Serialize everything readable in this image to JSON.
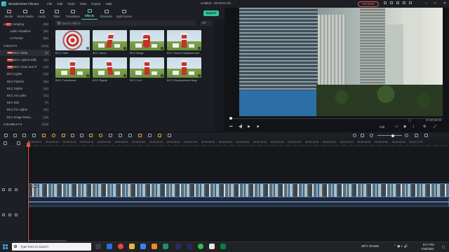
{
  "app": {
    "name": "Wondershare Filmora",
    "menu": [
      "File",
      "Edit",
      "Tools",
      "View",
      "Export",
      "Help"
    ],
    "document_title": "Untitled : 00:03:01:19",
    "purchase_label": "Purchase",
    "window_controls": [
      "–",
      "□",
      "✕"
    ]
  },
  "tabs": [
    {
      "label": "Media"
    },
    {
      "label": "Stock Media"
    },
    {
      "label": "Audio"
    },
    {
      "label": "Titles"
    },
    {
      "label": "Transitions"
    },
    {
      "label": "Effects"
    },
    {
      "label": "Elements"
    },
    {
      "label": "Split Screen"
    }
  ],
  "export_label": "Export",
  "search": {
    "placeholder": "Search effects",
    "filter": "All"
  },
  "categories": [
    {
      "label": "Camping",
      "count": "(39)",
      "hot": "HOT",
      "indent": 0
    },
    {
      "label": "Audio Visualizer",
      "count": "(25)",
      "hot": "",
      "indent": 1
    },
    {
      "label": "AI Portrait",
      "count": "(62)",
      "hot": "",
      "indent": 1
    },
    {
      "label": "Boris FX",
      "count": "(133)",
      "hot": "",
      "indent": 0
    },
    {
      "label": "BCC Warp",
      "count": "(8)",
      "hot": "NEW",
      "indent": 2
    },
    {
      "label": "BCC Optical Diffu...",
      "count": "(11)",
      "hot": "NEW",
      "indent": 2
    },
    {
      "label": "BCC Grain and Te...",
      "count": "(12)",
      "hot": "NEW",
      "indent": 2
    },
    {
      "label": "BCC Lights",
      "count": "(12)",
      "hot": "",
      "indent": 2
    },
    {
      "label": "BCC Particle",
      "count": "(11)",
      "hot": "",
      "indent": 2
    },
    {
      "label": "BCC Stylize",
      "count": "(11)",
      "hot": "",
      "indent": 2
    },
    {
      "label": "BCC Art Looks",
      "count": "(11)",
      "hot": "",
      "indent": 2
    },
    {
      "label": "BCC Blur",
      "count": "(7)",
      "hot": "",
      "indent": 2
    },
    {
      "label": "BCC Pro Lights",
      "count": "(11)",
      "hot": "",
      "indent": 2
    },
    {
      "label": "BCC Image Resto...",
      "count": "(13)",
      "hot": "",
      "indent": 2
    },
    {
      "label": "NewBlue FX",
      "count": "(112)",
      "hot": "",
      "indent": 0
    }
  ],
  "effects": [
    {
      "label": "BCC Twirl",
      "style": "twirl"
    },
    {
      "label": "BCC Wave",
      "style": "wave"
    },
    {
      "label": "BCC Bulge",
      "style": "bulge"
    },
    {
      "label": "BCC Vector Displacement",
      "style": "plain"
    },
    {
      "label": "BCC Turbulence",
      "style": "plain"
    },
    {
      "label": "BCC Ripple",
      "style": "ripple"
    },
    {
      "label": "BCC Curl",
      "style": "plain"
    },
    {
      "label": "BCC Displacement Map",
      "style": "plain"
    }
  ],
  "preview": {
    "current_time": "00:00:00:00",
    "quality": "Full",
    "braces": "{      }"
  },
  "timeline": {
    "ruler": [
      "00:00:00:00",
      "00:00:00:20",
      "00:00:01:15",
      "00:00:02:10",
      "00:00:03:05",
      "00:00:04:00",
      "00:00:04:20",
      "00:00:05:15",
      "00:00:06:10",
      "00:00:07:05",
      "00:00:08:00",
      "00:00:08:20",
      "00:00:09:15",
      "00:00:10:10",
      "00:00:11:05",
      "00:00:12:00",
      "00:00:12:20",
      "00:00:13:15",
      "00:00:14:10",
      "00:00:15:05",
      "00:00:16:00",
      "00:00:16:20",
      "00:00:17:15"
    ],
    "clip_label": "Video"
  },
  "taskbar": {
    "search_placeholder": "Type here to search",
    "weather": "28°C  Smoke",
    "time": "9:17 PM",
    "date": "7/28/2022"
  },
  "colors": {
    "accent": "#31c49e",
    "playhead": "#e8553f",
    "clip": "#4f86c6"
  }
}
